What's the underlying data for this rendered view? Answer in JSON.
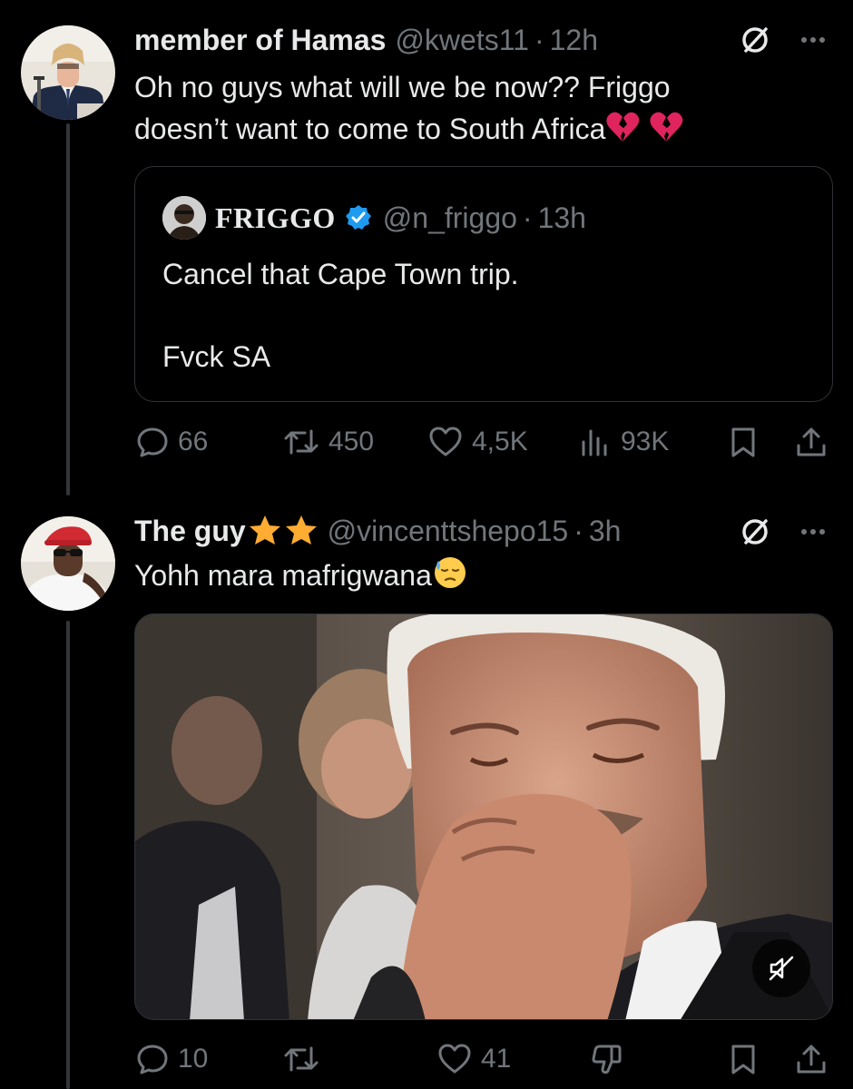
{
  "tweet1": {
    "name": "member of Hamas",
    "handle": "@kwets11",
    "time": "12h",
    "text_line1": "Oh no guys what will we be now?? Friggo",
    "text_line2": "doesn’t want to come to South Africa",
    "quote": {
      "name": "FRIGGO",
      "handle": "@n_friggo",
      "time": "13h",
      "line1": "Cancel that Cape Town trip.",
      "line2": "Fvck SA"
    },
    "actions": {
      "replies": "66",
      "reposts": "450",
      "likes": "4,5K",
      "views": "93K"
    }
  },
  "tweet2": {
    "name": "The guy",
    "handle": "@vincenttshepo15",
    "time": "3h",
    "text": "Yohh mara mafrigwana",
    "actions": {
      "replies": "10",
      "likes": "41"
    }
  },
  "separator": "·",
  "colors": {
    "background": "#000000",
    "text": "#e7e9ea",
    "muted": "#71767b",
    "border": "#2f3336",
    "verified": "#1d9bf0",
    "broken_heart": "#e0245e",
    "star": "#ffac33"
  },
  "icons": [
    "grok-icon",
    "more-icon",
    "verified-badge-icon",
    "reply-icon",
    "repost-icon",
    "like-icon",
    "views-icon",
    "bookmark-icon",
    "share-icon",
    "downvote-icon",
    "mute-icon"
  ]
}
